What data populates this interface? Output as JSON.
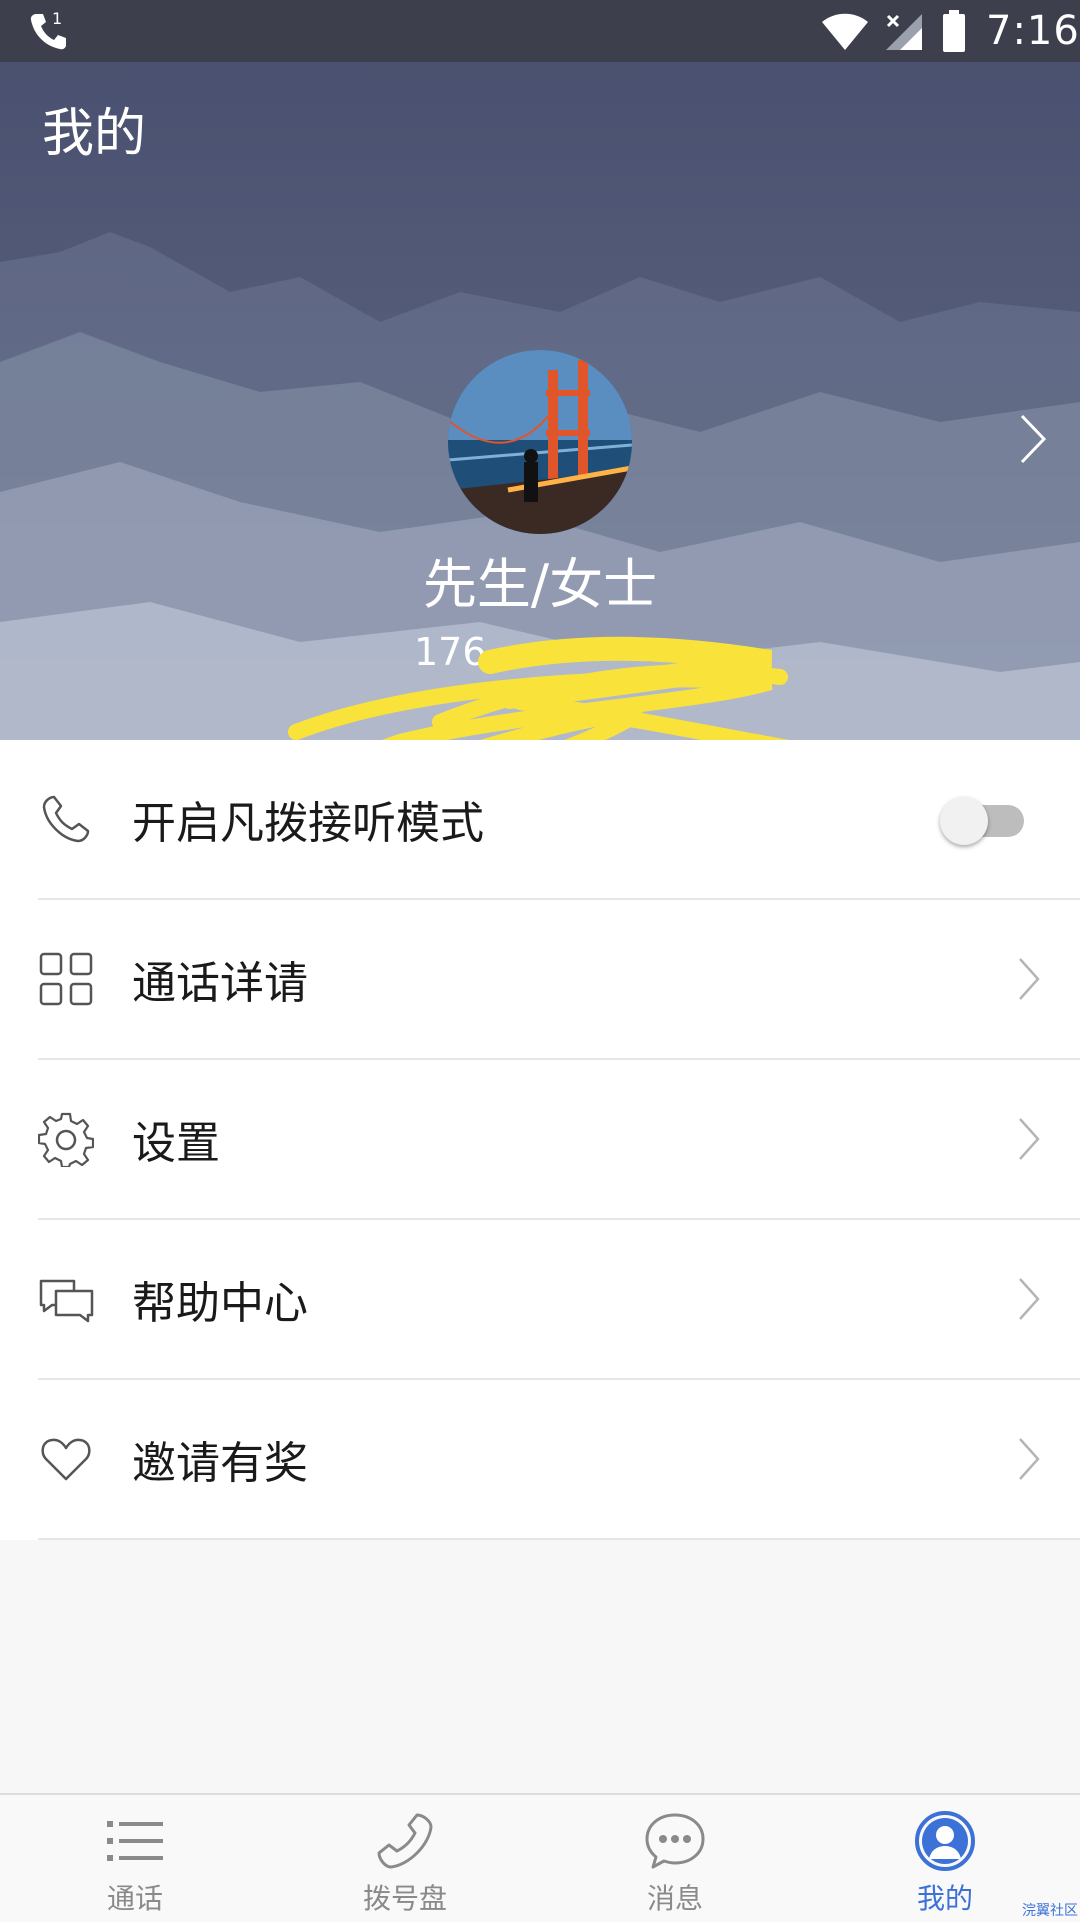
{
  "status_bar": {
    "time": "7:16"
  },
  "header": {
    "title": "我的",
    "username": "先生/女士",
    "phone_partial": "176"
  },
  "menu": {
    "items": [
      {
        "icon": "phone-icon",
        "label": "开启凡拨接听模式",
        "control": "toggle",
        "toggle_on": false
      },
      {
        "icon": "grid-icon",
        "label": "通话详请",
        "control": "chevron"
      },
      {
        "icon": "gear-icon",
        "label": "设置",
        "control": "chevron"
      },
      {
        "icon": "chat-bubbles-icon",
        "label": "帮助中心",
        "control": "chevron"
      },
      {
        "icon": "heart-icon",
        "label": "邀请有奖",
        "control": "chevron"
      }
    ]
  },
  "tabbar": {
    "tabs": [
      {
        "icon": "list-icon",
        "label": "通话",
        "active": false
      },
      {
        "icon": "phone-icon",
        "label": "拨号盘",
        "active": false
      },
      {
        "icon": "message-icon",
        "label": "消息",
        "active": false
      },
      {
        "icon": "user-icon",
        "label": "我的",
        "active": true
      }
    ]
  },
  "colors": {
    "status_bar_bg": "#3d3f4c",
    "accent": "#3c71d8",
    "inactive_tab": "#8a8a8a",
    "scribble": "#f9e33a"
  },
  "watermark": "浣翼社区"
}
